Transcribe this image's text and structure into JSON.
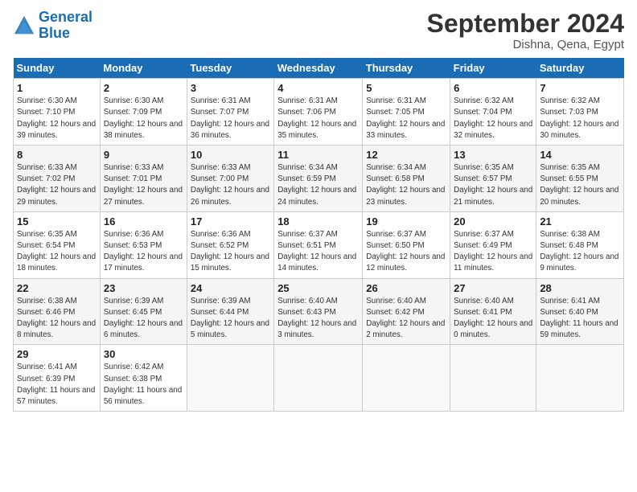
{
  "header": {
    "logo_line1": "General",
    "logo_line2": "Blue",
    "month": "September 2024",
    "location": "Dishna, Qena, Egypt"
  },
  "days_of_week": [
    "Sunday",
    "Monday",
    "Tuesday",
    "Wednesday",
    "Thursday",
    "Friday",
    "Saturday"
  ],
  "weeks": [
    [
      {
        "num": "1",
        "sunrise": "6:30 AM",
        "sunset": "7:10 PM",
        "daylight": "12 hours and 39 minutes."
      },
      {
        "num": "2",
        "sunrise": "6:30 AM",
        "sunset": "7:09 PM",
        "daylight": "12 hours and 38 minutes."
      },
      {
        "num": "3",
        "sunrise": "6:31 AM",
        "sunset": "7:07 PM",
        "daylight": "12 hours and 36 minutes."
      },
      {
        "num": "4",
        "sunrise": "6:31 AM",
        "sunset": "7:06 PM",
        "daylight": "12 hours and 35 minutes."
      },
      {
        "num": "5",
        "sunrise": "6:31 AM",
        "sunset": "7:05 PM",
        "daylight": "12 hours and 33 minutes."
      },
      {
        "num": "6",
        "sunrise": "6:32 AM",
        "sunset": "7:04 PM",
        "daylight": "12 hours and 32 minutes."
      },
      {
        "num": "7",
        "sunrise": "6:32 AM",
        "sunset": "7:03 PM",
        "daylight": "12 hours and 30 minutes."
      }
    ],
    [
      {
        "num": "8",
        "sunrise": "6:33 AM",
        "sunset": "7:02 PM",
        "daylight": "12 hours and 29 minutes."
      },
      {
        "num": "9",
        "sunrise": "6:33 AM",
        "sunset": "7:01 PM",
        "daylight": "12 hours and 27 minutes."
      },
      {
        "num": "10",
        "sunrise": "6:33 AM",
        "sunset": "7:00 PM",
        "daylight": "12 hours and 26 minutes."
      },
      {
        "num": "11",
        "sunrise": "6:34 AM",
        "sunset": "6:59 PM",
        "daylight": "12 hours and 24 minutes."
      },
      {
        "num": "12",
        "sunrise": "6:34 AM",
        "sunset": "6:58 PM",
        "daylight": "12 hours and 23 minutes."
      },
      {
        "num": "13",
        "sunrise": "6:35 AM",
        "sunset": "6:57 PM",
        "daylight": "12 hours and 21 minutes."
      },
      {
        "num": "14",
        "sunrise": "6:35 AM",
        "sunset": "6:55 PM",
        "daylight": "12 hours and 20 minutes."
      }
    ],
    [
      {
        "num": "15",
        "sunrise": "6:35 AM",
        "sunset": "6:54 PM",
        "daylight": "12 hours and 18 minutes."
      },
      {
        "num": "16",
        "sunrise": "6:36 AM",
        "sunset": "6:53 PM",
        "daylight": "12 hours and 17 minutes."
      },
      {
        "num": "17",
        "sunrise": "6:36 AM",
        "sunset": "6:52 PM",
        "daylight": "12 hours and 15 minutes."
      },
      {
        "num": "18",
        "sunrise": "6:37 AM",
        "sunset": "6:51 PM",
        "daylight": "12 hours and 14 minutes."
      },
      {
        "num": "19",
        "sunrise": "6:37 AM",
        "sunset": "6:50 PM",
        "daylight": "12 hours and 12 minutes."
      },
      {
        "num": "20",
        "sunrise": "6:37 AM",
        "sunset": "6:49 PM",
        "daylight": "12 hours and 11 minutes."
      },
      {
        "num": "21",
        "sunrise": "6:38 AM",
        "sunset": "6:48 PM",
        "daylight": "12 hours and 9 minutes."
      }
    ],
    [
      {
        "num": "22",
        "sunrise": "6:38 AM",
        "sunset": "6:46 PM",
        "daylight": "12 hours and 8 minutes."
      },
      {
        "num": "23",
        "sunrise": "6:39 AM",
        "sunset": "6:45 PM",
        "daylight": "12 hours and 6 minutes."
      },
      {
        "num": "24",
        "sunrise": "6:39 AM",
        "sunset": "6:44 PM",
        "daylight": "12 hours and 5 minutes."
      },
      {
        "num": "25",
        "sunrise": "6:40 AM",
        "sunset": "6:43 PM",
        "daylight": "12 hours and 3 minutes."
      },
      {
        "num": "26",
        "sunrise": "6:40 AM",
        "sunset": "6:42 PM",
        "daylight": "12 hours and 2 minutes."
      },
      {
        "num": "27",
        "sunrise": "6:40 AM",
        "sunset": "6:41 PM",
        "daylight": "12 hours and 0 minutes."
      },
      {
        "num": "28",
        "sunrise": "6:41 AM",
        "sunset": "6:40 PM",
        "daylight": "11 hours and 59 minutes."
      }
    ],
    [
      {
        "num": "29",
        "sunrise": "6:41 AM",
        "sunset": "6:39 PM",
        "daylight": "11 hours and 57 minutes."
      },
      {
        "num": "30",
        "sunrise": "6:42 AM",
        "sunset": "6:38 PM",
        "daylight": "11 hours and 56 minutes."
      },
      null,
      null,
      null,
      null,
      null
    ]
  ]
}
